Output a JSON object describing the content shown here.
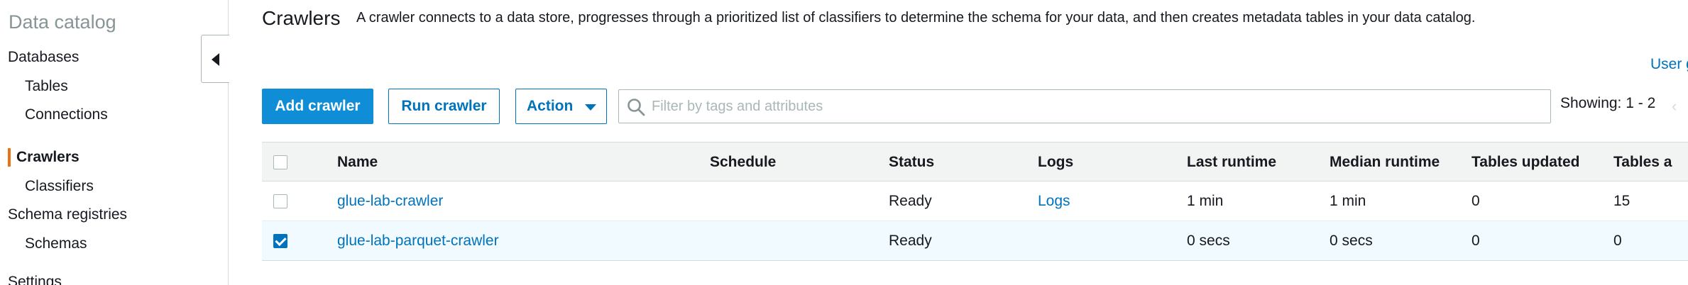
{
  "sidebar": {
    "title": "Data catalog",
    "items": [
      {
        "label": "Databases"
      },
      {
        "label": "Tables"
      },
      {
        "label": "Connections"
      },
      {
        "label": "Crawlers"
      },
      {
        "label": "Classifiers"
      },
      {
        "label": "Schema registries"
      },
      {
        "label": "Schemas"
      },
      {
        "label": "Settings"
      }
    ],
    "active_item": "Crawlers",
    "active_color": "#ec7211"
  },
  "header": {
    "title": "Crawlers",
    "description": "A crawler connects to a data store, progresses through a prioritized list of classifiers to determine the schema for your data, and then creates metadata tables in your data catalog.",
    "user_link": "User g"
  },
  "toolbar": {
    "add_label": "Add crawler",
    "run_label": "Run crawler",
    "action_label": "Action",
    "search_placeholder": "Filter by tags and attributes",
    "search_value": "",
    "showing": "Showing: 1 - 2"
  },
  "table": {
    "columns": [
      "Name",
      "Schedule",
      "Status",
      "Logs",
      "Last runtime",
      "Median runtime",
      "Tables updated",
      "Tables a"
    ],
    "rows": [
      {
        "checked": false,
        "name": "glue-lab-crawler",
        "schedule": "",
        "status": "Ready",
        "logs": "Logs",
        "last_runtime": "1 min",
        "median_runtime": "1 min",
        "tables_updated": "0",
        "tables_added": "15"
      },
      {
        "checked": true,
        "name": "glue-lab-parquet-crawler",
        "schedule": "",
        "status": "Ready",
        "logs": "",
        "last_runtime": "0 secs",
        "median_runtime": "0 secs",
        "tables_updated": "0",
        "tables_added": "0"
      }
    ]
  },
  "colors": {
    "primary": "#0f8dd6",
    "link": "#0073bb",
    "selected_row": "#f1faff"
  }
}
